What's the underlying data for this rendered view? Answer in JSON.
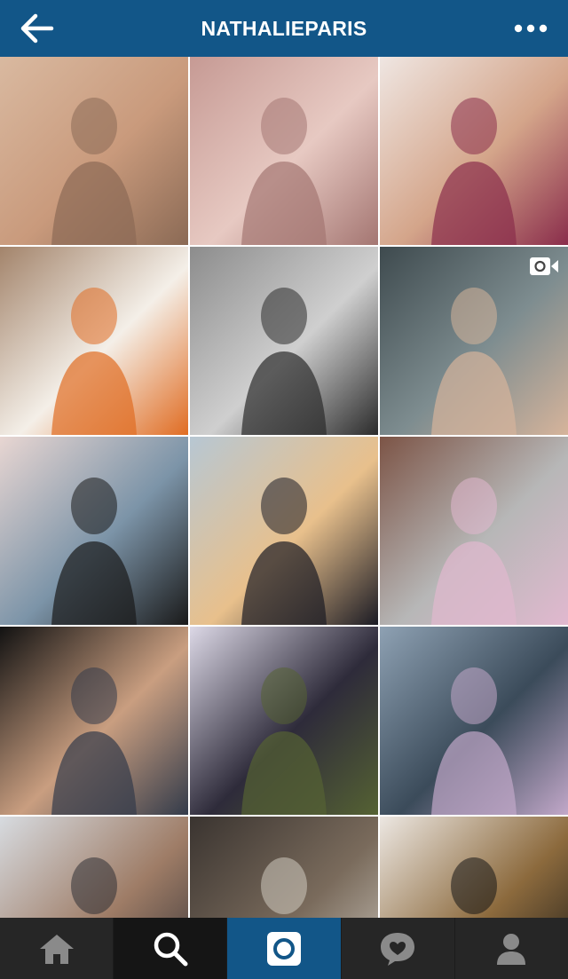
{
  "header": {
    "title": "NATHALIEPARIS",
    "back_icon": "arrow-left-icon",
    "more_icon": "more-dots-icon",
    "background": "#125688"
  },
  "grid": {
    "columns": 3,
    "tiles": [
      {
        "kind": "photo",
        "palette": [
          "#d9b9a0",
          "#8b6a55",
          "#c99a7c"
        ]
      },
      {
        "kind": "photo",
        "palette": [
          "#c69a94",
          "#a47672",
          "#e7c9c2"
        ]
      },
      {
        "kind": "photo",
        "palette": [
          "#efe6e2",
          "#8a2d4b",
          "#d4a58a"
        ]
      },
      {
        "kind": "photo",
        "palette": [
          "#a3846b",
          "#e06c22",
          "#f4efe8"
        ]
      },
      {
        "kind": "photo",
        "palette": [
          "#8c8c8c",
          "#2b2b2b",
          "#cfcfcf"
        ]
      },
      {
        "kind": "video",
        "palette": [
          "#3e4a4e",
          "#d6b49b",
          "#7e8d90"
        ]
      },
      {
        "kind": "photo",
        "palette": [
          "#e8d6d2",
          "#1a1a1a",
          "#7c94a8"
        ]
      },
      {
        "kind": "photo",
        "palette": [
          "#b7c7d3",
          "#1b1b24",
          "#e8c08c"
        ]
      },
      {
        "kind": "photo",
        "palette": [
          "#7c5446",
          "#e1b8cf",
          "#b7b7b7"
        ]
      },
      {
        "kind": "photo",
        "palette": [
          "#121212",
          "#333b4a",
          "#c99e80"
        ]
      },
      {
        "kind": "photo",
        "palette": [
          "#dcd8e6",
          "#556233",
          "#2e2b3a"
        ]
      },
      {
        "kind": "photo",
        "palette": [
          "#8ea1b3",
          "#c2a8c9",
          "#3b4b5a"
        ]
      },
      {
        "kind": "photo",
        "palette": [
          "#d7dbe0",
          "#2f2f35",
          "#9e7c66"
        ]
      },
      {
        "kind": "photo",
        "palette": [
          "#3a3430",
          "#cfcac0",
          "#7a6b5c"
        ]
      },
      {
        "kind": "photo",
        "palette": [
          "#ece7e2",
          "#161616",
          "#8c6a3d"
        ]
      }
    ]
  },
  "tabbar": {
    "tabs": [
      {
        "name": "home",
        "icon": "home-icon"
      },
      {
        "name": "search",
        "icon": "search-icon"
      },
      {
        "name": "camera",
        "icon": "camera-icon"
      },
      {
        "name": "activity",
        "icon": "heart-bubble-icon"
      },
      {
        "name": "profile",
        "icon": "person-icon"
      }
    ],
    "background": "#262626",
    "camera_background": "#125688",
    "icon_color": "#8a8a8a"
  }
}
